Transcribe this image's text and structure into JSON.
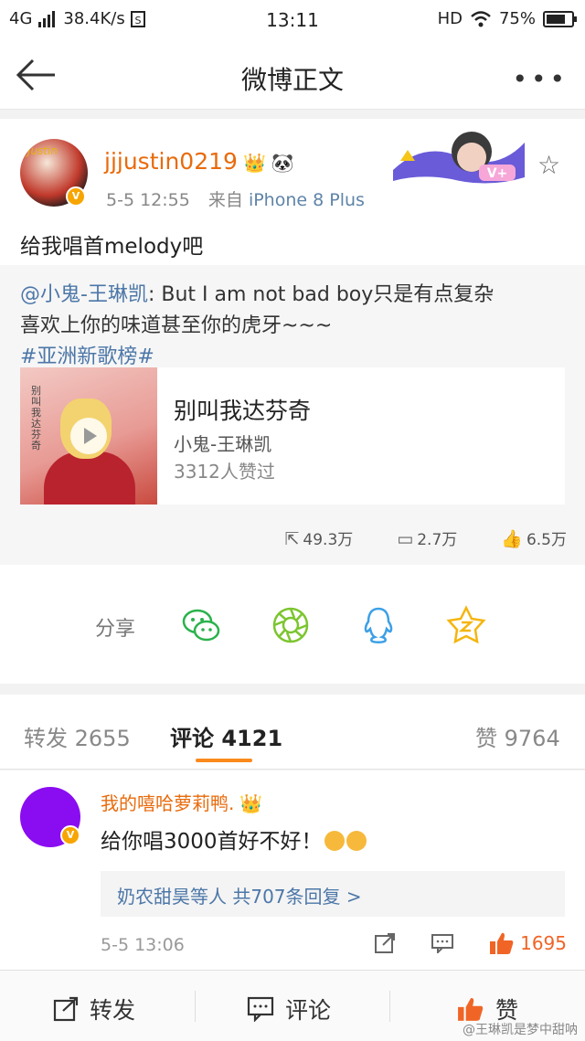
{
  "status_bar": {
    "network": "4G",
    "speed": "38.4K/s",
    "time": "13:11",
    "hd": "HD",
    "battery": "75%",
    "battery_level": 0.75
  },
  "nav": {
    "title": "微博正文",
    "back_icon": "arrow-left-icon",
    "more_icon": "ellipsis-icon"
  },
  "post": {
    "author": "jjjustin0219",
    "avatar_text": "Justin",
    "time": "5-5 12:55",
    "from_label": "来自",
    "device": "iPhone 8 Plus",
    "text": "给我唱首melody吧",
    "verified_badge": "V",
    "repost": {
      "mention": "@小鬼-王琳凯",
      "text_line1": ": But I am not bad boy只是有点复杂",
      "text_line2": "喜欢上你的味道甚至你的虎牙~~~",
      "topic": "#亚洲新歌榜#",
      "card": {
        "title": "别叫我达芬奇",
        "artist": "小鬼-王琳凯",
        "likes": "3312人赞过",
        "cover_text": "别叫我达芬奇"
      },
      "stats": {
        "reposts": "49.3万",
        "comments": "2.7万",
        "likes": "6.5万"
      }
    }
  },
  "share": {
    "label": "分享",
    "targets": [
      "wechat-icon",
      "moments-icon",
      "qq-icon",
      "qzone-icon"
    ]
  },
  "tabs": {
    "repost_label": "转发",
    "repost_count": "2655",
    "comment_label": "评论",
    "comment_count": "4121",
    "like_label": "赞",
    "like_count": "9764"
  },
  "comment": {
    "author": "我的嘻哈萝莉鸭.",
    "text": "给你唱3000首好不好！",
    "replies_users": "奶农甜昊等人",
    "replies_count": "共707条回复",
    "replies_arrow": ">",
    "time": "5-5 13:06",
    "likes": "1695"
  },
  "bottom_bar": {
    "repost": "转发",
    "comment": "评论",
    "like": "赞"
  },
  "watermark": "@王琳凯是梦中甜呐",
  "colors": {
    "accent_orange": "#f98a1b",
    "username": "#e86b0c",
    "link": "#4c77a8",
    "like_red": "#f06526"
  }
}
